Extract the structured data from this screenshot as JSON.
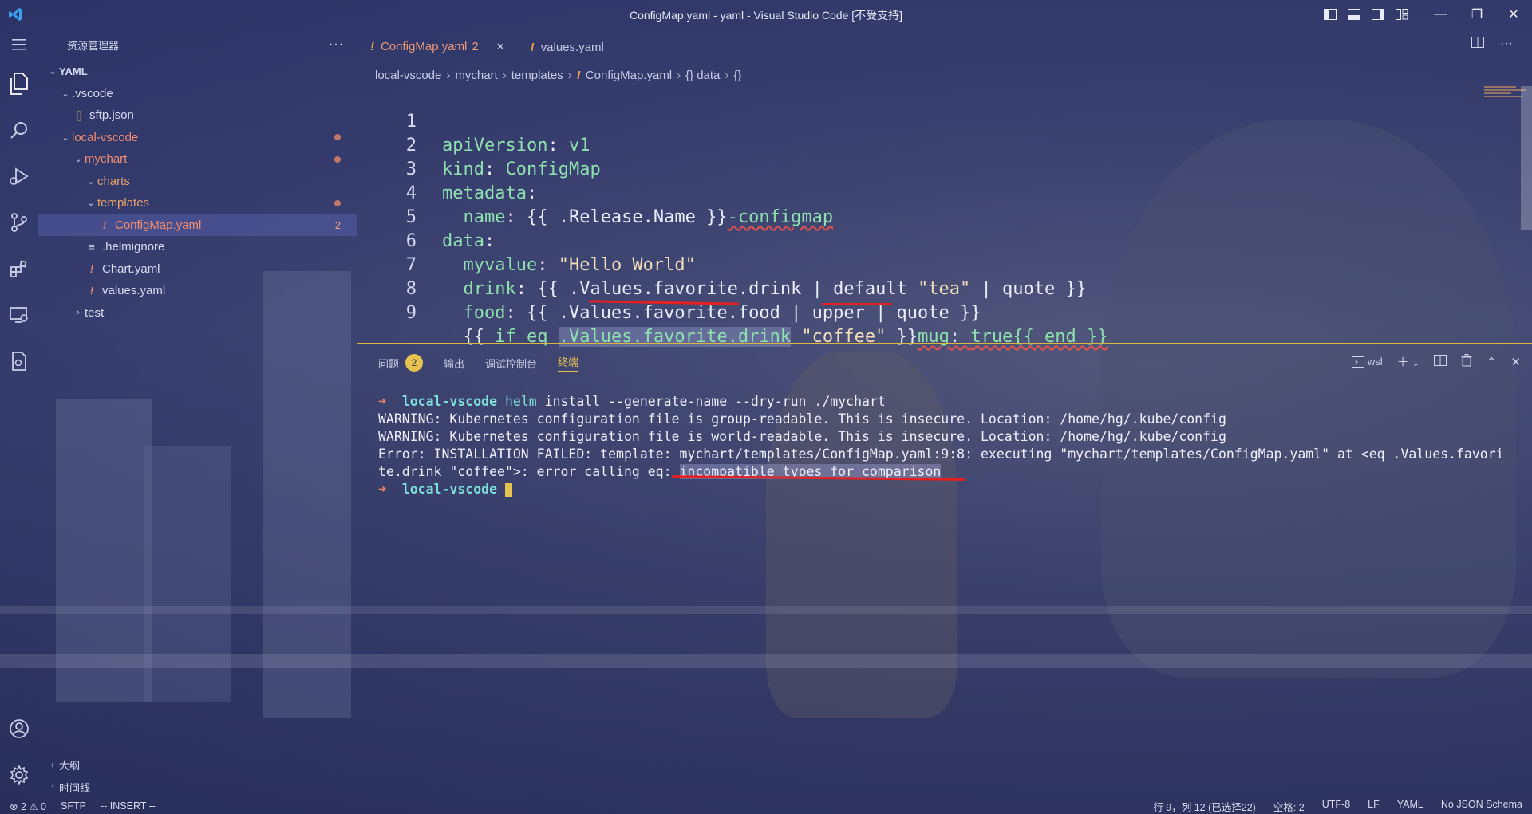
{
  "titlebar": {
    "title": "ConfigMap.yaml - yaml - Visual Studio Code [不受支持]",
    "logo": "vscode-logo"
  },
  "sidebar": {
    "header": "资源管理器",
    "more": "···",
    "tree": [
      {
        "label": "YAML",
        "kind": "section",
        "indent": 0,
        "chevron": "⌄"
      },
      {
        "label": ".vscode",
        "kind": "folder",
        "indent": 1,
        "chevron": "⌄"
      },
      {
        "label": "sftp.json",
        "kind": "file",
        "indent": 2,
        "icon": "{}"
      },
      {
        "label": "local-vscode",
        "kind": "folder",
        "indent": 1,
        "chevron": "⌄",
        "modified": true
      },
      {
        "label": "mychart",
        "kind": "folder",
        "indent": 2,
        "chevron": "⌄",
        "modified": true
      },
      {
        "label": "charts",
        "kind": "folder",
        "indent": 3,
        "chevron": "⌄"
      },
      {
        "label": "templates",
        "kind": "folder",
        "indent": 3,
        "chevron": "⌄",
        "modified": true
      },
      {
        "label": "ConfigMap.yaml",
        "kind": "file",
        "indent": 4,
        "icon": "!",
        "problems": "2",
        "selected": true
      },
      {
        "label": ".helmignore",
        "kind": "file",
        "indent": 3,
        "icon": "≡"
      },
      {
        "label": "Chart.yaml",
        "kind": "file",
        "indent": 3,
        "icon": "!"
      },
      {
        "label": "values.yaml",
        "kind": "file",
        "indent": 3,
        "icon": "!"
      },
      {
        "label": "test",
        "kind": "folder",
        "indent": 2,
        "chevron": "›"
      }
    ],
    "bottom": [
      {
        "label": "大纲"
      },
      {
        "label": "时间线"
      }
    ]
  },
  "tabs": [
    {
      "label": "ConfigMap.yaml",
      "problems": "2",
      "active": true,
      "close": "✕"
    },
    {
      "label": "values.yaml",
      "active": false
    }
  ],
  "breadcrumb": [
    "local-vscode",
    "mychart",
    "templates",
    "ConfigMap.yaml",
    "data",
    "{}"
  ],
  "editor": {
    "lines": [
      {
        "n": "1"
      },
      {
        "n": "2"
      },
      {
        "n": "3"
      },
      {
        "n": "4"
      },
      {
        "n": "5"
      },
      {
        "n": "6"
      },
      {
        "n": "7"
      },
      {
        "n": "8"
      },
      {
        "n": "9"
      }
    ]
  },
  "panel": {
    "tabs": [
      {
        "label": "问题",
        "badge": "2"
      },
      {
        "label": "输出"
      },
      {
        "label": "调试控制台"
      },
      {
        "label": "终端",
        "active": true
      }
    ],
    "shell": "wsl",
    "terminal": {
      "line1_dir": "local-vscode",
      "line1_cmd": "helm",
      "line1_args": " install --generate-name --dry-run ./mychart",
      "line2": "WARNING: Kubernetes configuration file is group-readable. This is insecure. Location: /home/hg/.kube/config",
      "line3": "WARNING: Kubernetes configuration file is world-readable. This is insecure. Location: /home/hg/.kube/config",
      "line4": "Error: INSTALLATION FAILED: template: mychart/templates/ConfigMap.yaml:9:8: executing \"mychart/templates/ConfigMap.yaml\" at <eq .Values.favori",
      "line5_pre": "te.drink \"coffee\">: error calling eq: ",
      "line5_sel": "incompatible types for comparison",
      "line6_dir": "local-vscode"
    }
  },
  "statusbar": {
    "problems": "⊗ 2 ⚠ 0",
    "sftp": "SFTP",
    "mode": "-- INSERT --",
    "position": "行 9，列 12 (已选择22)",
    "spaces": "空格: 2",
    "encoding": "UTF-8",
    "eol": "LF",
    "language": "YAML",
    "schema": "No JSON Schema"
  },
  "colors": {
    "accent": "#e6c350",
    "error": "#e62020",
    "key": "#8ee0b0",
    "string": "#f2dcbc"
  }
}
